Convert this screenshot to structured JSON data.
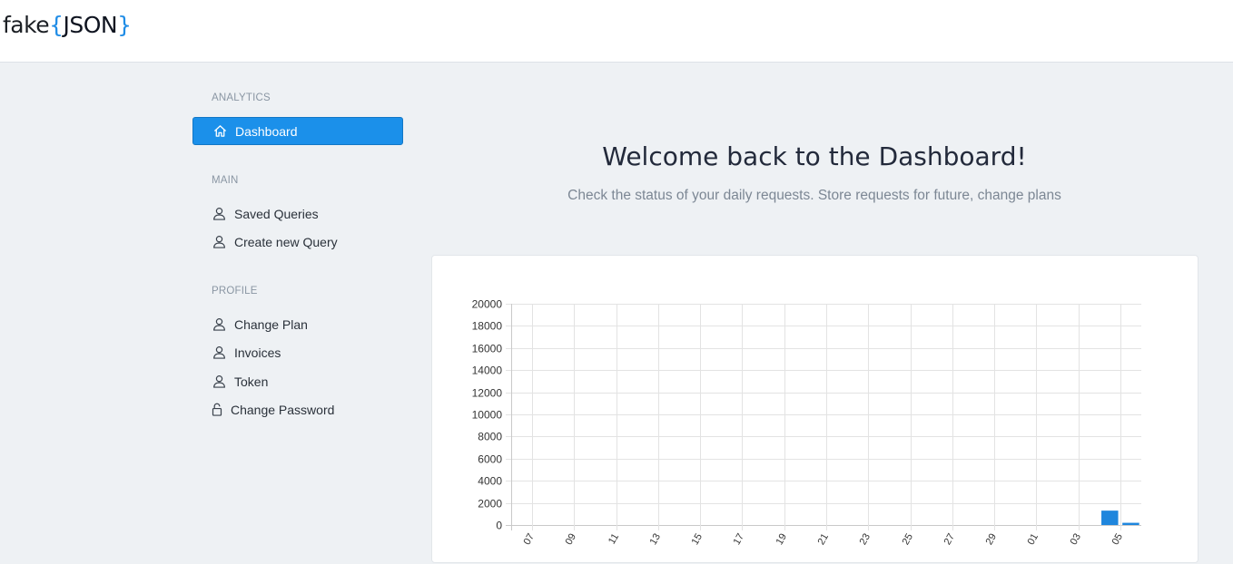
{
  "header": {
    "logo": {
      "prefix": "fake",
      "open_brace": "{",
      "word": "JSON",
      "close_brace": "}"
    }
  },
  "sidebar": {
    "sections": [
      {
        "title": "ANALYTICS",
        "items": [
          {
            "label": "Dashboard",
            "icon": "home-icon",
            "active": true
          }
        ]
      },
      {
        "title": "MAIN",
        "items": [
          {
            "label": "Saved Queries",
            "icon": "user-icon",
            "active": false
          },
          {
            "label": "Create new Query",
            "icon": "user-icon",
            "active": false
          }
        ]
      },
      {
        "title": "PROFILE",
        "items": [
          {
            "label": "Change Plan",
            "icon": "user-icon",
            "active": false
          },
          {
            "label": "Invoices",
            "icon": "user-icon",
            "active": false
          },
          {
            "label": "Token",
            "icon": "user-icon",
            "active": false
          },
          {
            "label": "Change Password",
            "icon": "lock-icon",
            "active": false
          }
        ]
      }
    ]
  },
  "main": {
    "title": "Welcome back to the Dashboard!",
    "subtitle": "Check the status of your daily requests. Store requests for future, change plans"
  },
  "colors": {
    "accent": "#1b90ea",
    "bar": "#1f86dd",
    "background": "#eef1f4"
  },
  "chart_data": {
    "type": "bar",
    "x_tick_labels": [
      "07",
      "09",
      "11",
      "13",
      "15",
      "17",
      "19",
      "21",
      "23",
      "25",
      "27",
      "29",
      "01",
      "03",
      "05"
    ],
    "values": [
      0,
      0,
      0,
      0,
      0,
      0,
      0,
      0,
      0,
      0,
      0,
      0,
      0,
      0,
      0,
      0,
      0,
      0,
      0,
      0,
      0,
      0,
      0,
      0,
      0,
      0,
      0,
      0,
      1300,
      200
    ],
    "y_ticks": [
      0,
      2000,
      4000,
      6000,
      8000,
      10000,
      12000,
      14000,
      16000,
      18000,
      20000
    ],
    "ylim": [
      0,
      20000
    ],
    "grid": true,
    "legend": "none",
    "title": "",
    "xlabel": "",
    "ylabel": ""
  }
}
